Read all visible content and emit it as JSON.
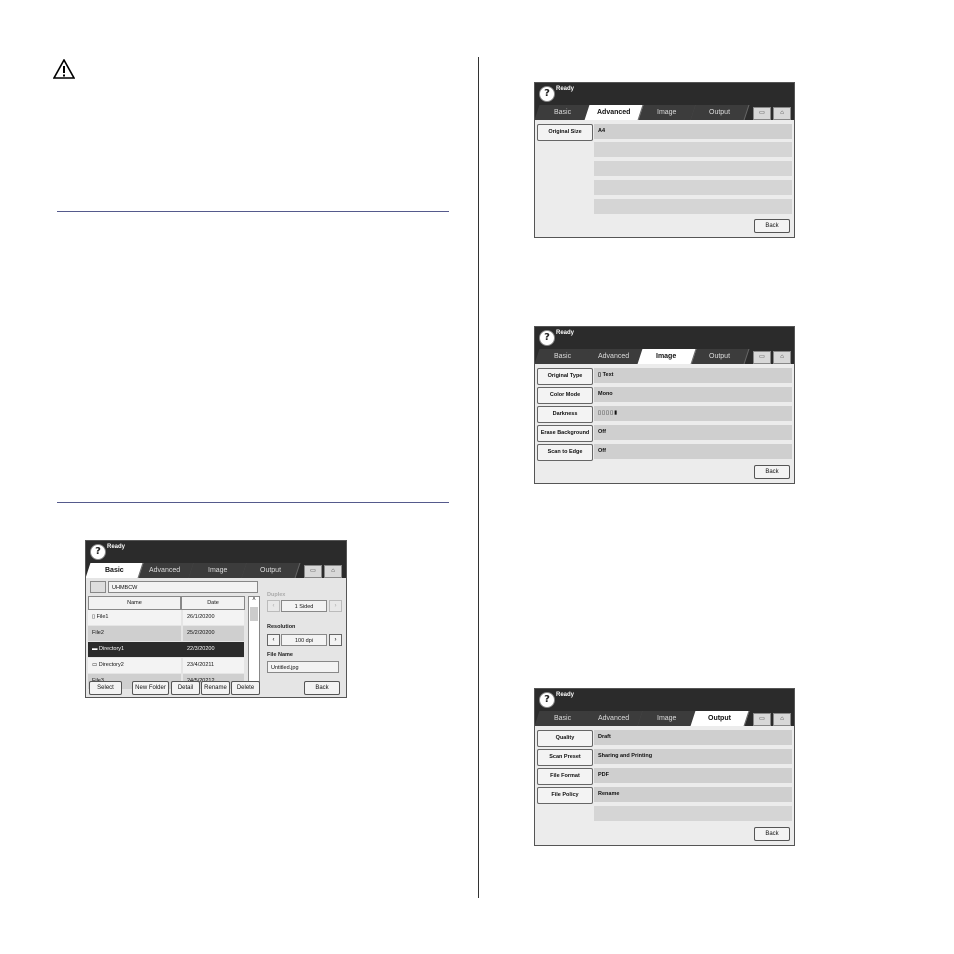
{
  "panel_file": {
    "ready": "Ready",
    "tabs": [
      "Basic",
      "Advanced",
      "Image",
      "Output"
    ],
    "path": "UHMBCW",
    "columns": [
      "Name",
      "Date"
    ],
    "rows": [
      {
        "name": "File1",
        "date": "26/1/20200"
      },
      {
        "name": "File2",
        "date": "25/2/20200"
      },
      {
        "name": "Directory1",
        "date": "22/3/20200"
      },
      {
        "name": "Directory2",
        "date": "23/4/20211"
      },
      {
        "name": "File3",
        "date": "24/5/20212"
      }
    ],
    "duplex_label": "Duplex",
    "duplex_value": "1 Sided",
    "resolution_label": "Resolution",
    "resolution_value": "100 dpi",
    "filename_label": "File Name",
    "filename_value": "Untitled.jpg",
    "buttons": [
      "Select",
      "New Folder",
      "Detail",
      "Rename",
      "Delete",
      "Back"
    ]
  },
  "panel_advanced": {
    "ready": "Ready",
    "tabs": [
      "Basic",
      "Advanced",
      "Image",
      "Output"
    ],
    "label": "Original Size",
    "value": "A4",
    "back": "Back"
  },
  "panel_image": {
    "ready": "Ready",
    "tabs": [
      "Basic",
      "Advanced",
      "Image",
      "Output"
    ],
    "labels": [
      "Original Type",
      "Color Mode",
      "Darkness",
      "Erase Background",
      "Scan to Edge"
    ],
    "values": [
      "Text",
      "Mono",
      "",
      "Off",
      "Off"
    ],
    "back": "Back"
  },
  "panel_output": {
    "ready": "Ready",
    "tabs": [
      "Basic",
      "Advanced",
      "Image",
      "Output"
    ],
    "labels": [
      "Quality",
      "Scan Preset",
      "File Format",
      "File Policy"
    ],
    "values": [
      "Draft",
      "Sharing and Printing",
      "PDF",
      "Rename"
    ],
    "back": "Back"
  }
}
